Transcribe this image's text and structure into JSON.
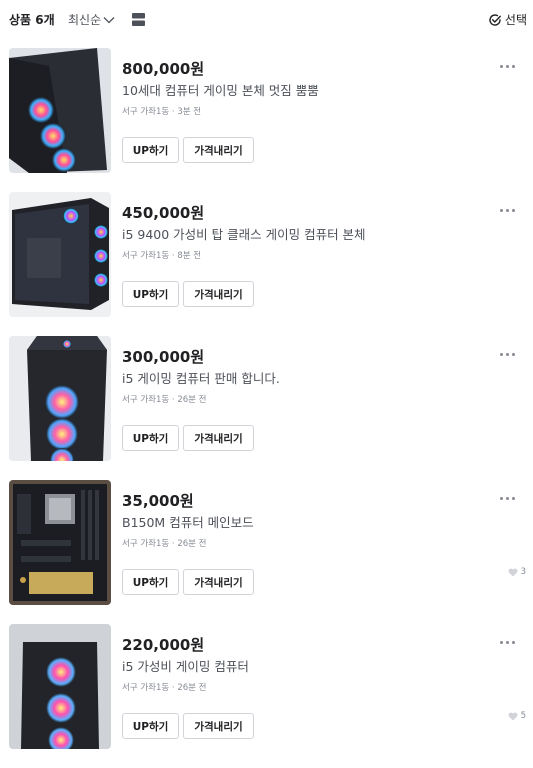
{
  "header": {
    "count_label": "상품 6개",
    "sort_label": "최신순",
    "select_label": "선택"
  },
  "items": [
    {
      "price": "800,000원",
      "title": "10세대 컴퓨터 게이밍 본체 멋짐 뿜뿜",
      "location": "서구 가좌1동",
      "time": "3분 전",
      "likes": "",
      "up_label": "UP하기",
      "down_label": "가격내리기"
    },
    {
      "price": "450,000원",
      "title": "i5 9400 가성비 탑 클래스 게이밍 컴퓨터 본체",
      "location": "서구 가좌1동",
      "time": "8분 전",
      "likes": "",
      "up_label": "UP하기",
      "down_label": "가격내리기"
    },
    {
      "price": "300,000원",
      "title": "i5 게이밍 컴퓨터 판매 합니다.",
      "location": "서구 가좌1동",
      "time": "26분 전",
      "likes": "",
      "up_label": "UP하기",
      "down_label": "가격내리기"
    },
    {
      "price": "35,000원",
      "title": "B150M 컴퓨터 메인보드",
      "location": "서구 가좌1동",
      "time": "26분 전",
      "likes": "3",
      "up_label": "UP하기",
      "down_label": "가격내리기"
    },
    {
      "price": "220,000원",
      "title": "i5 가성비 게이밍 컴퓨터",
      "location": "서구 가좌1동",
      "time": "26분 전",
      "likes": "5",
      "up_label": "UP하기",
      "down_label": "가격내리기"
    }
  ],
  "meta_separator": " · "
}
